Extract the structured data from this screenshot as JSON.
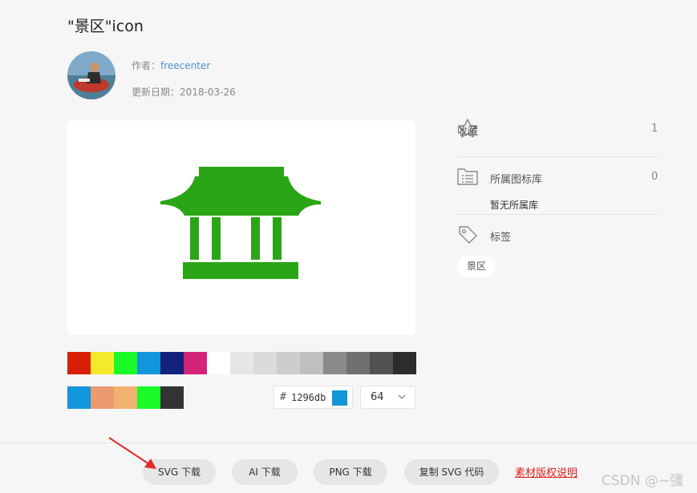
{
  "page": {
    "title": "\"景区\"icon"
  },
  "author": {
    "label": "作者：",
    "name": "freecenter"
  },
  "update": {
    "label": "更新日期：",
    "date": "2018-03-26"
  },
  "icon": {
    "color": "#2aa515",
    "icon_name": "pavilion-scenic-spot"
  },
  "palette_primary": [
    "#d81e06",
    "#f4ea2a",
    "#1afa29",
    "#1296db",
    "#13227a",
    "#d4237a",
    "#ffffff",
    "#e6e6e6",
    "#dbdbdb",
    "#cdcdcd",
    "#bfbfbf",
    "#8a8a8a",
    "#707070",
    "#515151",
    "#2c2c2c"
  ],
  "palette_recent": [
    "#1296db",
    "#ec9a71",
    "#efb270",
    "#1afa29",
    "#333333"
  ],
  "color_input": {
    "hash": "#",
    "value": "1296db",
    "chip": "#1296db"
  },
  "size_select": {
    "value": "64"
  },
  "sidebar": {
    "favorite": {
      "label": "收藏",
      "count": "1",
      "icon": "star-icon"
    },
    "library": {
      "label": "所属图标库",
      "count": "0",
      "icon": "library-icon",
      "empty": "暂无所属库"
    },
    "tags": {
      "label": "标签",
      "icon": "tag-icon",
      "items": [
        "景区"
      ]
    }
  },
  "buttons": {
    "svg": "SVG 下载",
    "ai": "AI 下载",
    "png": "PNG 下载",
    "copy_svg": "复制 SVG 代码"
  },
  "license_link": "素材版权说明",
  "watermark": "CSDN @~彊",
  "colors": {
    "accent_link": "#4a8fc7",
    "license_red": "#e02020",
    "arrow_red": "#e02b2b"
  }
}
